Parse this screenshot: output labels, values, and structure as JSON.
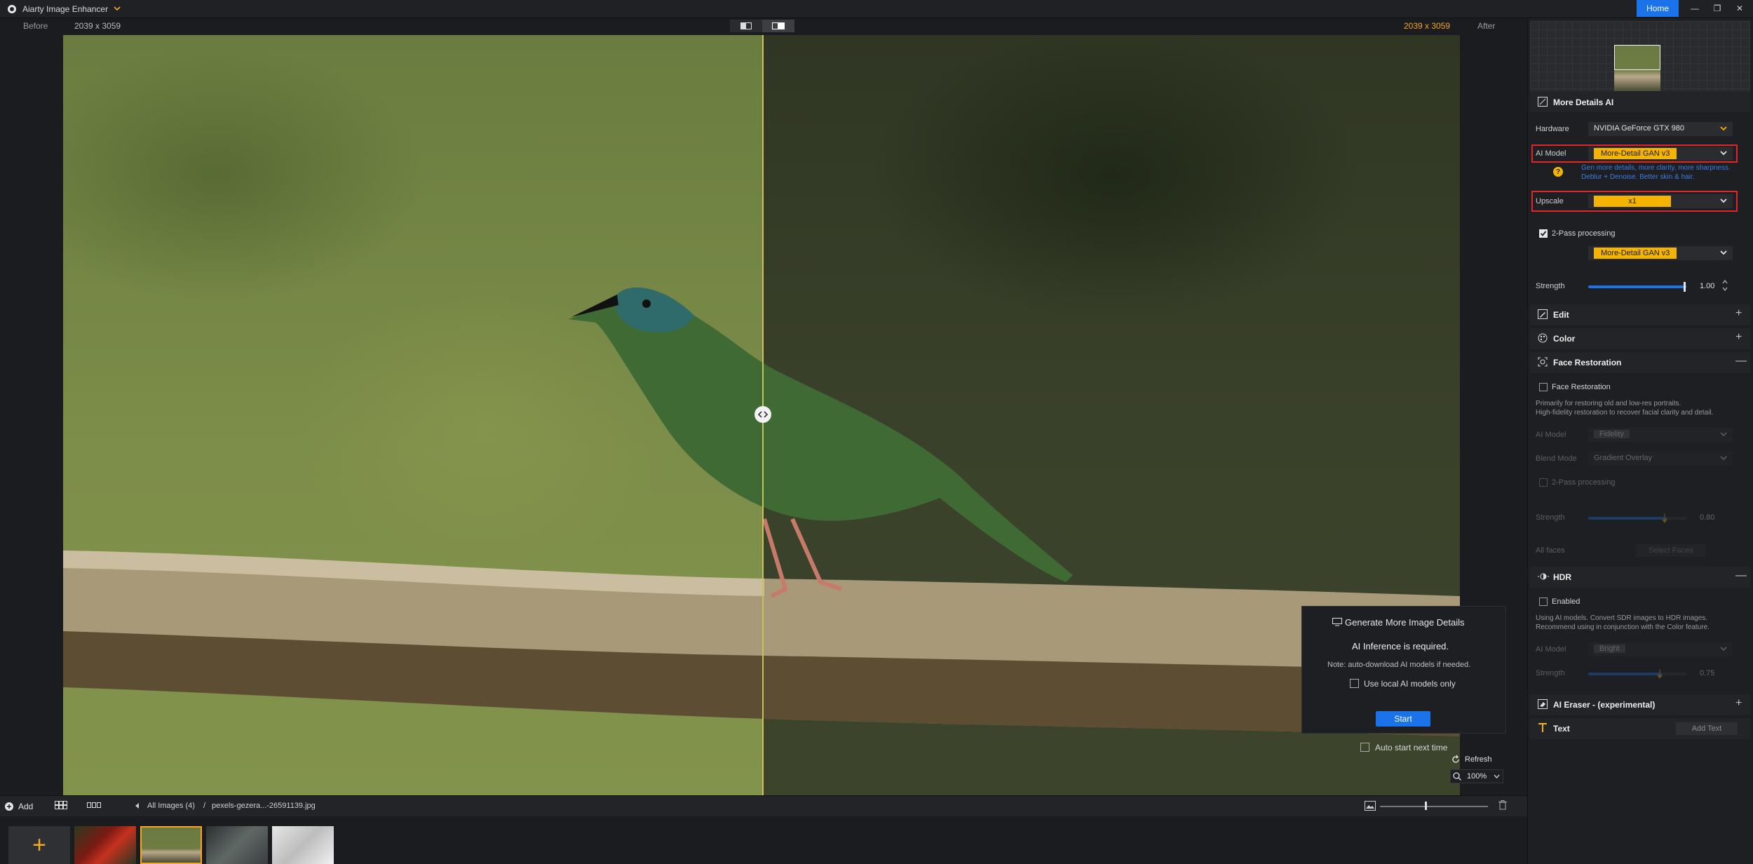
{
  "titlebar": {
    "app_title": "Aiarty Image Enhancer",
    "home_label": "Home",
    "minimize_glyph": "—",
    "restore_glyph": "❐",
    "close_glyph": "✕"
  },
  "compare": {
    "before_label": "Before",
    "before_size": "2039 x 3059",
    "after_size": "2039 x 3059",
    "after_label": "After",
    "split_position_fraction": 0.5
  },
  "generate_panel": {
    "title": "Generate More Image Details",
    "required_text": "AI Inference is required.",
    "note": "Note: auto-download AI models if needed.",
    "local_only_label": "Use local AI models only",
    "local_only_checked": false,
    "start_label": "Start",
    "auto_start_label": "Auto start next time",
    "auto_start_checked": false
  },
  "view_controls": {
    "refresh_label": "Refresh",
    "zoom_label": "100%"
  },
  "bottombar": {
    "add_label": "Add",
    "crumb_all": "All Images (4)",
    "crumb_sep": "/",
    "crumb_file": "pexels-gezera...-26591139.jpg",
    "thumb_size_fraction": 0.42
  },
  "filmstrip": {
    "add_glyph": "+",
    "thumbnails": [
      "red-parrot",
      "green-bird-on-branch",
      "grey-bird",
      "white-bird"
    ],
    "selected_index": 1
  },
  "rightpanel": {
    "more_details": {
      "title": "More Details AI",
      "hardware_label": "Hardware",
      "hardware_value": "NVIDIA GeForce GTX 980",
      "ai_model_label": "AI Model",
      "ai_model_value": "More-Detail GAN  v3",
      "help_glyph": "?",
      "model_desc_line1": "Gen more details, more clarity, more sharpness.",
      "model_desc_line2": "Deblur + Denoise. Better skin & hair.",
      "upscale_label": "Upscale",
      "upscale_value": "x1",
      "two_pass_label": "2-Pass processing",
      "two_pass_checked": true,
      "two_pass_model": "More-Detail GAN  v3",
      "strength_label": "Strength",
      "strength_value": "1.00",
      "strength_fraction": 1.0
    },
    "edit": {
      "title": "Edit",
      "toggle": "+"
    },
    "color": {
      "title": "Color",
      "toggle": "+"
    },
    "face": {
      "title": "Face Restoration",
      "toggle": "—",
      "enable_label": "Face Restoration",
      "desc_line1": "Primarily for restoring old and low-res portraits.",
      "desc_line2": "High-fidelity restoration to recover facial clarity and detail.",
      "ai_model_label": "AI Model",
      "ai_model_value": "Fidelity",
      "blend_label": "Blend Mode",
      "blend_value": "Gradient Overlay",
      "two_pass_label": "2-Pass processing",
      "strength_label": "Strength",
      "strength_value": "0.80",
      "strength_fraction": 0.8,
      "faces_label": "All faces",
      "select_faces_label": "Select Faces"
    },
    "hdr": {
      "title": "HDR",
      "toggle": "—",
      "enable_label": "Enabled",
      "desc_line1": "Using AI models. Convert SDR images to HDR images.",
      "desc_line2": "Recommend using in conjunction with the Color feature.",
      "ai_model_label": "AI Model",
      "ai_model_value": "Bright",
      "strength_label": "Strength",
      "strength_value": "0.75",
      "strength_fraction": 0.75
    },
    "eraser": {
      "title": "AI Eraser - (experimental)",
      "toggle": "+"
    },
    "text": {
      "title": "Text",
      "add_text_label": "Add Text"
    }
  },
  "colors": {
    "accent_blue": "#1a73e8",
    "accent_orange": "#f5a623",
    "highlight_red": "#e0262b",
    "tag_yellow": "#f5b400"
  }
}
